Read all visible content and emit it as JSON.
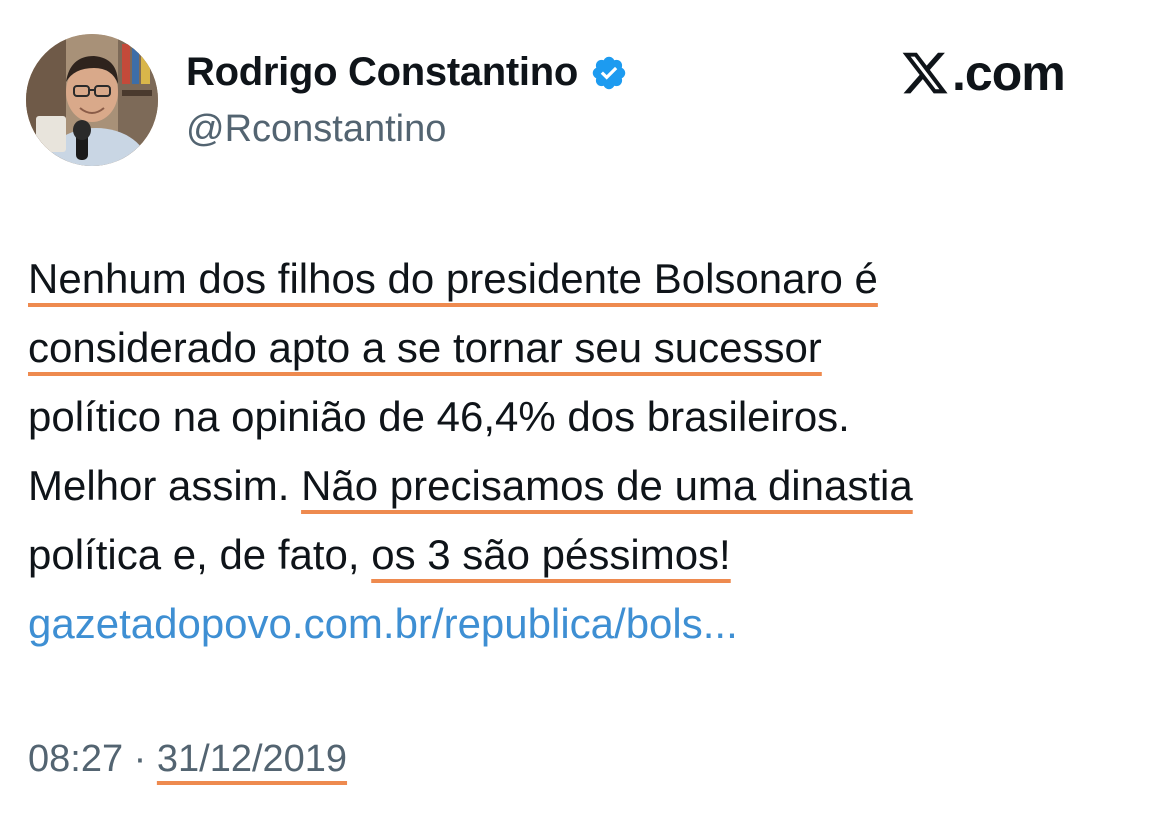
{
  "author": {
    "display_name": "Rodrigo Constantino",
    "handle": "@Rconstantino",
    "verified_icon": "verified-badge-icon",
    "verified_color": "#1d9bf0"
  },
  "brand": {
    "label": ".com",
    "icon": "x-logo-icon"
  },
  "tweet": {
    "lines": [
      [
        {
          "text": "Nenhum dos filhos do presidente Bolsonaro é",
          "underline": true
        }
      ],
      [
        {
          "text": "considerado apto a se tornar seu sucessor",
          "underline": true
        }
      ],
      [
        {
          "text": "político na opinião de 46,4% dos brasileiros.",
          "underline": false
        }
      ],
      [
        {
          "text": "Melhor assim. ",
          "underline": false
        },
        {
          "text": "Não precisamos de uma dinastia",
          "underline": true
        }
      ],
      [
        {
          "text": "política e, de fato, ",
          "underline": false
        },
        {
          "text": "os 3 são péssimos!",
          "underline": true
        }
      ]
    ],
    "link": "gazetadopovo.com.br/republica/bols...",
    "link_color": "#3e8fd3"
  },
  "meta": {
    "time": "08:27",
    "separator": " · ",
    "date": "31/12/2019"
  },
  "colors": {
    "highlight_underline": "#ee8a4f",
    "secondary_text": "#536471"
  }
}
